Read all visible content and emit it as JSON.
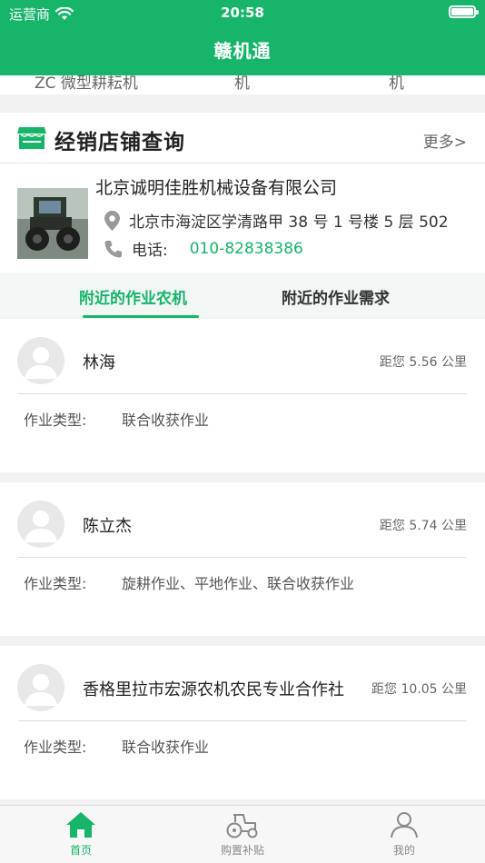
{
  "status": {
    "carrier": "运营商",
    "time": "20:58"
  },
  "nav": {
    "title": "赣机通"
  },
  "categories": [
    "ZC 微型耕耘机",
    "机",
    "机"
  ],
  "store_section": {
    "title": "经销店铺查询",
    "more": "更多>",
    "store": {
      "name": "北京诚明佳胜机械设备有限公司",
      "address": "北京市海淀区学清路甲 38 号 1 号楼 5 层 502",
      "phone_label": "电话:",
      "phone": "010-82838386"
    }
  },
  "tabs": {
    "active": "附近的作业农机",
    "other": "附近的作业需求"
  },
  "cards": [
    {
      "name": "林海",
      "distance": "距您 5.56 公里",
      "type_label": "作业类型:",
      "type_value": "联合收获作业"
    },
    {
      "name": "陈立杰",
      "distance": "距您 5.74 公里",
      "type_label": "作业类型:",
      "type_value": "旋耕作业、平地作业、联合收获作业"
    },
    {
      "name": "香格里拉市宏源农机农民专业合作社",
      "distance": "距您 10.05 公里",
      "type_label": "作业类型:",
      "type_value": "联合收获作业"
    }
  ],
  "tabbar": {
    "home": "首页",
    "subsidy": "购置补贴",
    "me": "我的"
  },
  "colors": {
    "brand": "#16b56a"
  }
}
